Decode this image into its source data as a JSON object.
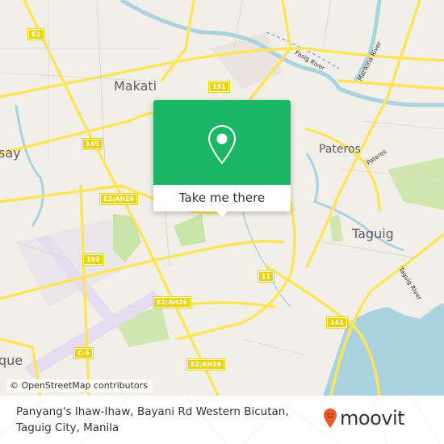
{
  "map": {
    "places": [
      {
        "id": "makati",
        "label": "Makati"
      },
      {
        "id": "pasay",
        "label": "say"
      },
      {
        "id": "pateros",
        "label": "Pateros"
      },
      {
        "id": "taguig",
        "label": "Taguig"
      },
      {
        "id": "paranaque",
        "label": "que"
      }
    ],
    "road_shields": [
      {
        "id": "e2-top",
        "label": "E2"
      },
      {
        "id": "r191",
        "label": "191"
      },
      {
        "id": "r145",
        "label": "145"
      },
      {
        "id": "e2ah26-1",
        "label": "E2;AH26"
      },
      {
        "id": "r192",
        "label": "192"
      },
      {
        "id": "e2ah26-2",
        "label": "E2;AH26"
      },
      {
        "id": "r11",
        "label": "11"
      },
      {
        "id": "r142",
        "label": "142"
      },
      {
        "id": "c5",
        "label": "C-5"
      },
      {
        "id": "e2ah26-3",
        "label": "E2;AH26"
      }
    ],
    "water_labels": [
      {
        "id": "pasig-river",
        "label": "Pasig River"
      },
      {
        "id": "marikina-river",
        "label": "Marikina River"
      },
      {
        "id": "pateros-river",
        "label": "Pateros"
      },
      {
        "id": "taguig-river",
        "label": "Taguig River"
      }
    ],
    "attribution": "© OpenStreetMap contributors"
  },
  "popup": {
    "icon": "location-pin-icon",
    "button_label": "Take me there",
    "color": "#1cb766"
  },
  "footer": {
    "address": "Panyang's Ihaw-Ihaw, Bayani Rd Western Bicutan, Taguig City, Manila",
    "brand": "moovit",
    "brand_icon": "moovit-pin-icon",
    "brand_color": "#f1592a"
  }
}
